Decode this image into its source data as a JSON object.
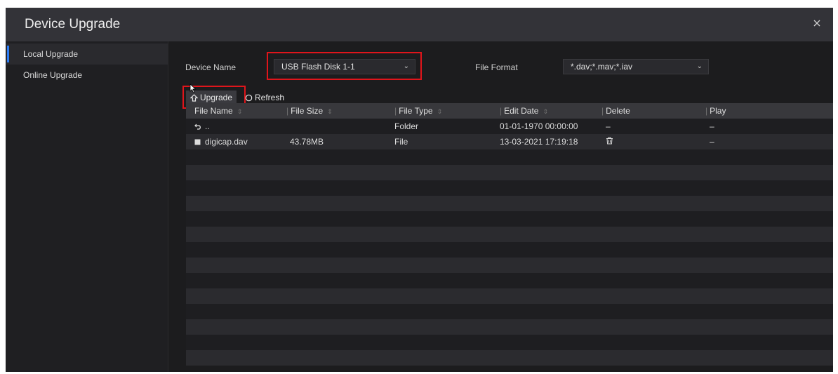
{
  "dialog": {
    "title": "Device Upgrade",
    "close_icon": "close-icon"
  },
  "sidebar": {
    "items": [
      {
        "label": "Local Upgrade",
        "active": true
      },
      {
        "label": "Online Upgrade",
        "active": false
      }
    ]
  },
  "form": {
    "device_name_label": "Device Name",
    "device_name_value": "USB Flash Disk 1-1",
    "file_format_label": "File Format",
    "file_format_value": "*.dav;*.mav;*.iav"
  },
  "toolbar": {
    "upgrade_label": "Upgrade",
    "refresh_label": "Refresh"
  },
  "table": {
    "columns": [
      "File Name",
      "File Size",
      "File Type",
      "Edit Date",
      "Delete",
      "Play"
    ],
    "rows": [
      {
        "name": "..",
        "icon": "back-icon",
        "size": "",
        "type": "Folder",
        "date": "01-01-1970 00:00:00",
        "delete": "–",
        "play": "–"
      },
      {
        "name": "digicap.dav",
        "icon": "file-icon",
        "size": "43.78MB",
        "type": "File",
        "date": "13-03-2021 17:19:18",
        "delete": "trash-icon",
        "play": "–"
      }
    ]
  },
  "colors": {
    "accent": "#2d7df6",
    "highlight": "#e0151b"
  }
}
